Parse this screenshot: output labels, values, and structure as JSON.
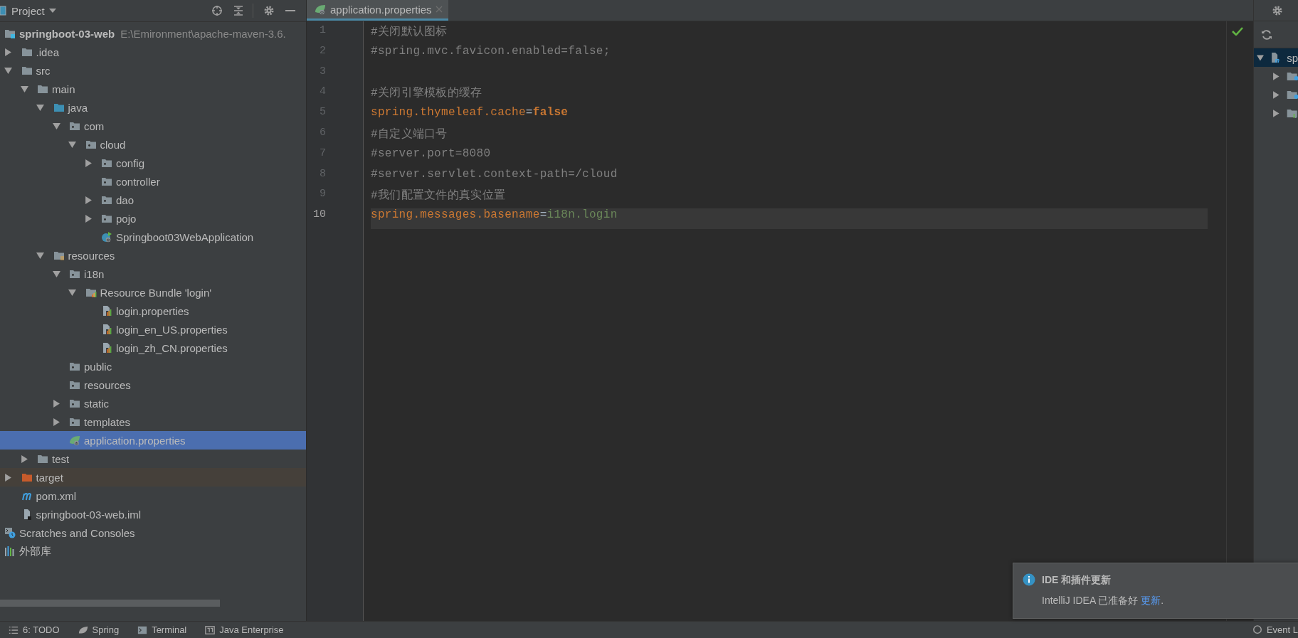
{
  "project_panel": {
    "title": "Project",
    "tree": [
      {
        "label": "springboot-03-web",
        "path": "E:\\Emironment\\apache-maven-3.6.",
        "kind": "module",
        "selected": false,
        "children": [
          {
            "label": ".idea",
            "kind": "folder",
            "expanded": false,
            "selected": false
          },
          {
            "label": "src",
            "kind": "folder",
            "expanded": true,
            "selected": false,
            "children": [
              {
                "label": "main",
                "kind": "folder",
                "expanded": true,
                "selected": false,
                "children": [
                  {
                    "label": "java",
                    "kind": "source_folder",
                    "expanded": true,
                    "selected": false,
                    "children": [
                      {
                        "label": "com",
                        "kind": "package",
                        "expanded": true,
                        "selected": false,
                        "children": [
                          {
                            "label": "cloud",
                            "kind": "package",
                            "expanded": true,
                            "selected": false,
                            "children": [
                              {
                                "label": "config",
                                "kind": "package",
                                "expanded": false,
                                "selected": false
                              },
                              {
                                "label": "controller",
                                "kind": "package",
                                "selected": false
                              },
                              {
                                "label": "dao",
                                "kind": "package",
                                "expanded": false,
                                "selected": false
                              },
                              {
                                "label": "pojo",
                                "kind": "package",
                                "expanded": false,
                                "selected": false
                              },
                              {
                                "label": "Springboot03WebApplication",
                                "kind": "spring_class",
                                "selected": false
                              }
                            ]
                          }
                        ]
                      }
                    ]
                  },
                  {
                    "label": "resources",
                    "kind": "resource_root",
                    "expanded": true,
                    "selected": false,
                    "children": [
                      {
                        "label": "i18n",
                        "kind": "package",
                        "expanded": true,
                        "selected": false,
                        "children": [
                          {
                            "label": "Resource Bundle 'login'",
                            "kind": "bundle",
                            "expanded": true,
                            "selected": false,
                            "children": [
                              {
                                "label": "login.properties",
                                "kind": "properties",
                                "selected": false
                              },
                              {
                                "label": "login_en_US.properties",
                                "kind": "properties",
                                "selected": false
                              },
                              {
                                "label": "login_zh_CN.properties",
                                "kind": "properties",
                                "selected": false
                              }
                            ]
                          }
                        ]
                      },
                      {
                        "label": "public",
                        "kind": "package",
                        "selected": false
                      },
                      {
                        "label": "resources",
                        "kind": "package",
                        "selected": false
                      },
                      {
                        "label": "static",
                        "kind": "package",
                        "expanded": false,
                        "selected": false
                      },
                      {
                        "label": "templates",
                        "kind": "package",
                        "expanded": false,
                        "selected": false
                      },
                      {
                        "label": "application.properties",
                        "kind": "spring_properties",
                        "selected": true
                      }
                    ]
                  }
                ]
              },
              {
                "label": "test",
                "kind": "folder",
                "expanded": false,
                "selected": false
              }
            ]
          },
          {
            "label": "target",
            "kind": "excluded_folder",
            "expanded": false,
            "selected": false
          },
          {
            "label": "pom.xml",
            "kind": "maven",
            "selected": false
          },
          {
            "label": "springboot-03-web.iml",
            "kind": "iml",
            "selected": false
          }
        ]
      },
      {
        "label": "Scratches and Consoles",
        "kind": "scratches",
        "selected": false
      },
      {
        "label": "外部库",
        "kind": "libraries",
        "selected": false
      }
    ]
  },
  "editor": {
    "tabs": [
      {
        "label": "application.properties",
        "kind": "spring_properties",
        "selected": true
      }
    ],
    "lines": [
      {
        "number": "1",
        "current": false,
        "segments": [
          {
            "text": "#关闭默认图标",
            "kind": "comment"
          }
        ]
      },
      {
        "number": "2",
        "current": false,
        "segments": [
          {
            "text": "#spring.mvc.favicon.enabled=false;",
            "kind": "comment"
          }
        ]
      },
      {
        "number": "3",
        "current": false
      },
      {
        "number": "4",
        "current": false,
        "segments": [
          {
            "text": "#关闭引擎模板的缓存",
            "kind": "comment"
          }
        ]
      },
      {
        "number": "5",
        "current": false,
        "segments": [
          {
            "text": "spring.thymeleaf.cache",
            "kind": "key"
          },
          {
            "text": "=",
            "kind": "separator"
          },
          {
            "text": "false",
            "kind": "keyword"
          }
        ]
      },
      {
        "number": "6",
        "current": false,
        "segments": [
          {
            "text": "#自定义端口号",
            "kind": "comment"
          }
        ]
      },
      {
        "number": "7",
        "current": false,
        "segments": [
          {
            "text": "#server.port=8080",
            "kind": "comment"
          }
        ]
      },
      {
        "number": "8",
        "current": false,
        "segments": [
          {
            "text": "#server.servlet.context-path=/cloud",
            "kind": "comment"
          }
        ]
      },
      {
        "number": "9",
        "current": false,
        "segments": [
          {
            "text": "#我们配置文件的真实位置",
            "kind": "comment"
          }
        ]
      },
      {
        "number": "10",
        "current": true,
        "segments": [
          {
            "text": "spring.messages.basename",
            "kind": "key"
          },
          {
            "text": "=",
            "kind": "separator"
          },
          {
            "text": "i18n.login",
            "kind": "value"
          }
        ]
      }
    ]
  },
  "maven_panel": {
    "tree": [
      {
        "label": "sp",
        "kind": "maven_module",
        "expanded": true,
        "selected": true,
        "children": [
          {
            "kind": "gear_folder",
            "expanded": false
          },
          {
            "kind": "gear_folder",
            "expanded": false
          },
          {
            "kind": "bars_folder",
            "expanded": false
          }
        ]
      }
    ]
  },
  "notification": {
    "title": "IDE 和插件更新",
    "text": "IntelliJ IDEA 已准备好 ",
    "link": "更新",
    "end": "."
  },
  "tool_windows": [
    {
      "label": "6: TODO",
      "kind": "todo"
    },
    {
      "label": "Spring",
      "kind": "spring"
    },
    {
      "label": "Terminal",
      "kind": "terminal"
    },
    {
      "label": "Java Enterprise",
      "kind": "enterprise"
    }
  ],
  "event_log": {
    "label": "Event L"
  }
}
